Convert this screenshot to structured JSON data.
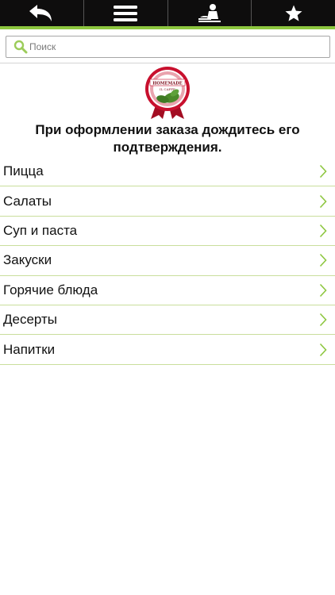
{
  "nav": {
    "buttons": [
      {
        "icon": "back-arrow-icon"
      },
      {
        "icon": "menu-icon"
      },
      {
        "icon": "waiter-icon"
      },
      {
        "icon": "star-icon"
      }
    ]
  },
  "search": {
    "placeholder": "Поиск",
    "value": ""
  },
  "logo": {
    "line1": "HOMEMADE",
    "line2": "IL CAFFE"
  },
  "notice": "При оформлении заказа дождитесь его подтверждения.",
  "categories": [
    {
      "label": "Пицца"
    },
    {
      "label": "Салаты"
    },
    {
      "label": "Суп и паста"
    },
    {
      "label": "Закуски"
    },
    {
      "label": "Горячие блюда"
    },
    {
      "label": "Десерты"
    },
    {
      "label": "Напитки"
    }
  ],
  "colors": {
    "topbar": "#0e0d0d",
    "accent": "#8dc63f",
    "chevron": "#8dc63f",
    "row_divider": "#c9de9c",
    "logo_red": "#c8102e"
  }
}
